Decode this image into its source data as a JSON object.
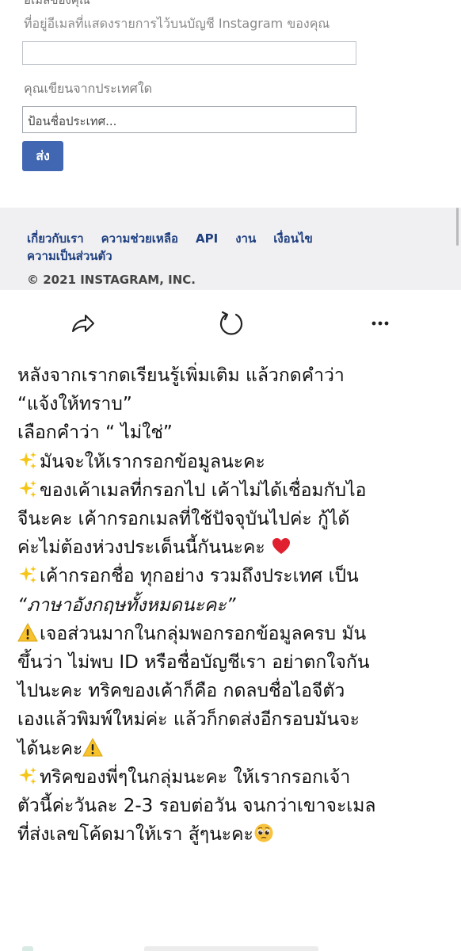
{
  "form": {
    "cut_label": "อีเมลของคุณ",
    "email_description": "ที่อยู่อีเมลที่แสดงรายการไว้บนบัญชี Instagram ของคุณ",
    "email_value": "",
    "country_label": "คุณเขียนจากประเทศใด",
    "country_placeholder": "ป้อนชื่อประเทศ...",
    "send_label": "ส่ง"
  },
  "footer": {
    "links": [
      "เกี่ยวกับเรา",
      "ความช่วยเหลือ",
      "API",
      "งาน",
      "เงื่อนไข",
      "ความเป็นส่วนตัว"
    ],
    "copyright": "© 2021 INSTAGRAM, INC."
  },
  "actions": {
    "icons": [
      "share-icon",
      "refresh-icon",
      "more-icon"
    ]
  },
  "post": {
    "lines": [
      "หลังจากเรากดเรียนรู้เพิ่มเติม แล้วกดคำว่า",
      "“แจ้งให้ทราบ”",
      "เลือกคำว่า “ ไม่ใช่”",
      "มันจะให้เรากรอกข้อมูลนะคะ",
      "ของเค้าเมลที่กรอกไป เค้าไม่ได้เชื่อมกับไอ",
      "จีนะคะ เค้ากรอกเมลที่ใช้ปัจจุบันไปค่ะ กู้ได้",
      "ค่ะไม่ต้องห่วงประเด็นนี้กันนะคะ",
      "เค้ากรอกชื่อ ทุกอย่าง รวมถึงประเทศ เป็น",
      " “ภาษาอังกฤษทั้งหมดนะคะ”",
      "เจอส่วนมากในกลุ่มพอกรอกข้อมูลครบ มัน",
      "ขึ้นว่า ไม่พบ ID หรือชื่อบัญชีเรา อย่าตกใจกัน",
      "ไปนะคะ ทริคของเค้าก็คือ กดลบชื่อไอจีตัว",
      "เองแล้วพิมพ์ใหม่ค่ะ แล้วก็กดส่งอีกรอบมันจะ",
      "ได้นะคะ",
      "ทริคของพี่ๆในกลุ่มนะคะ ให้เรากรอกเจ้า",
      "ตัวนี้ค่ะวันละ 2-3 รอบต่อวัน จนกว่าเขาจะเมล",
      "ที่ส่งเลขโค้ดมาให้เรา สู้ๆนะคะ"
    ],
    "emoji": {
      "sparkles": "sparkles-emoji",
      "heart": "red-heart-emoji",
      "warning": "warning-emoji",
      "pleading": "pleading-face-emoji"
    }
  },
  "colors": {
    "button_blue": "#4267b2",
    "footer_link": "#1f3f7f",
    "footer_bg": "#f0f0f2"
  }
}
